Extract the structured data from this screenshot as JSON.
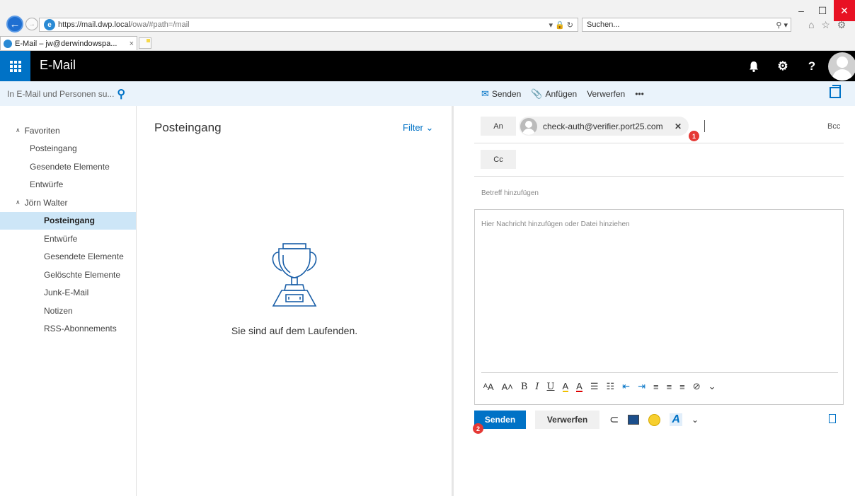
{
  "browser": {
    "url_host": "https://mail.dwp.local",
    "url_path": "/owa/#path=/mail",
    "addr_tools": "▾ 🔒 ↻",
    "search_placeholder": "Suchen...",
    "search_tools": "⚲ ▾",
    "tab_title": "E-Mail – jw@derwindowspa...",
    "tab_close": "×",
    "window_min": "–",
    "window_max": "☐",
    "window_close": "✕",
    "fav_icons": "⌂ ☆ ⚙"
  },
  "header": {
    "app_title": "E-Mail",
    "waffle_glyph": "⋮⋮⋮",
    "bell_glyph": "🔔",
    "gear_glyph": "⚙",
    "help_glyph": "?"
  },
  "cmdbar": {
    "search_placeholder": "In E-Mail und Personen su...",
    "send_label": "Senden",
    "attach_label": "Anfügen",
    "discard_label": "Verwerfen",
    "more_label": "•••"
  },
  "nav": {
    "favorites_header": "Favoriten",
    "favorites": [
      "Posteingang",
      "Gesendete Elemente",
      "Entwürfe"
    ],
    "account_header": "Jörn Walter",
    "folders": [
      "Posteingang",
      "Entwürfe",
      "Gesendete Elemente",
      "Gelöschte Elemente",
      "Junk-E-Mail",
      "Notizen",
      "RSS-Abonnements"
    ],
    "selected_folder": "Posteingang"
  },
  "message_list": {
    "title": "Posteingang",
    "filter_label": "Filter ⌄",
    "empty_text": "Sie sind auf dem Laufenden."
  },
  "compose": {
    "to_label": "An",
    "cc_label": "Cc",
    "bcc_label": "Bcc",
    "recipient": "check-auth@verifier.port25.com",
    "recipient_remove": "✕",
    "subject_placeholder": "Betreff hinzufügen",
    "body_placeholder": "Hier Nachricht hinzufügen oder Datei hinziehen",
    "send_button": "Senden",
    "discard_button": "Verwerfen"
  },
  "formatting": {
    "font_size": "ᴬA",
    "grow_font": "A˄",
    "bold": "B",
    "italic": "I",
    "underline": "U",
    "highlight": "A",
    "font_color": "A",
    "bullets": "☰",
    "numbering": "☷",
    "outdent": "⇤",
    "indent": "⇥",
    "align_left": "≡",
    "align_center": "≡",
    "align_right": "≡",
    "link": "⊘",
    "more": "⌄"
  },
  "markers": [
    "1",
    "2"
  ],
  "colors": {
    "accent": "#0072c6",
    "header_bg": "#000000",
    "selected_bg": "#cde6f7",
    "marker": "#e53935"
  }
}
